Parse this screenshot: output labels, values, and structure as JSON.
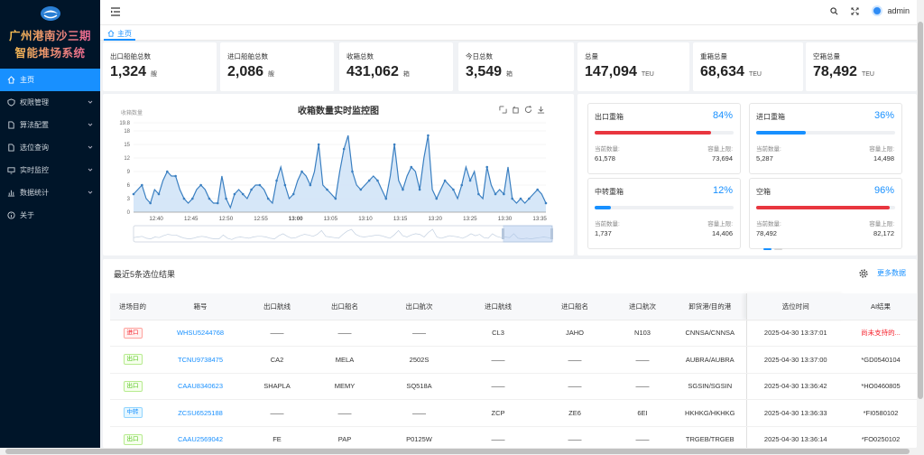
{
  "system_title_line1": "广州港南沙三期",
  "system_title_line2": "智能堆场系统",
  "menu": [
    {
      "label": "主页",
      "icon": "home-icon",
      "active": true
    },
    {
      "label": "权限管理",
      "icon": "shield-icon"
    },
    {
      "label": "算法配置",
      "icon": "doc-icon"
    },
    {
      "label": "选位查询",
      "icon": "doc-icon"
    },
    {
      "label": "实时监控",
      "icon": "monitor-icon"
    },
    {
      "label": "数据统计",
      "icon": "chart-icon"
    },
    {
      "label": "关于",
      "icon": "info-icon"
    }
  ],
  "header": {
    "user": "admin"
  },
  "tab": {
    "home": "主页"
  },
  "stats": [
    {
      "title": "出口船舶总数",
      "value": "1,324",
      "unit": "艘"
    },
    {
      "title": "进口船舶总数",
      "value": "2,086",
      "unit": "艘"
    },
    {
      "title": "收箱总数",
      "value": "431,062",
      "unit": "箱"
    },
    {
      "title": "今日总数",
      "value": "3,549",
      "unit": "箱"
    },
    {
      "title": "总量",
      "value": "147,094",
      "unit": "TEU"
    },
    {
      "title": "重箱总量",
      "value": "68,634",
      "unit": "TEU"
    },
    {
      "title": "空箱总量",
      "value": "78,492",
      "unit": "TEU"
    }
  ],
  "chart_data": {
    "type": "area",
    "title": "收箱数量实时监控图",
    "ylabel": "收箱数量",
    "ylim": [
      0,
      19.8
    ],
    "y_ticks": [
      "0",
      "3",
      "6",
      "9",
      "12",
      "15",
      "18",
      "19.8"
    ],
    "x_ticks": [
      "12:40",
      "12:45",
      "12:50",
      "12:55",
      "13:00",
      "13:05",
      "13:10",
      "13:15",
      "13:20",
      "13:25",
      "13:30",
      "13:35"
    ],
    "values": [
      4,
      5,
      6,
      3,
      2,
      5,
      4,
      7,
      9,
      8,
      8,
      5,
      3,
      2,
      3,
      5,
      6,
      5,
      3,
      2,
      2,
      8,
      3,
      1,
      4,
      5,
      4,
      3,
      5,
      6,
      6,
      5,
      3,
      2,
      7,
      10,
      6,
      3,
      4,
      7,
      9,
      8,
      6,
      9,
      15,
      6,
      5,
      4,
      3,
      9,
      14,
      17,
      9,
      6,
      5,
      6,
      7,
      8,
      7,
      5,
      3,
      8,
      15,
      7,
      5,
      8,
      10,
      9,
      5,
      12,
      17,
      5,
      3,
      5,
      7,
      6,
      5,
      3,
      6,
      10,
      7,
      9,
      4,
      3,
      10,
      6,
      4,
      5,
      4,
      10,
      3,
      2,
      3,
      2,
      3,
      4,
      5,
      4,
      2
    ]
  },
  "progress": [
    {
      "title": "出口重箱",
      "percent": 84,
      "pct_label": "84%",
      "color": "#e8363f",
      "cur_label": "当前数量:",
      "cur": "61,578",
      "cap_label": "容量上限:",
      "cap": "73,694"
    },
    {
      "title": "进口重箱",
      "percent": 36,
      "pct_label": "36%",
      "color": "#1890ff",
      "cur_label": "当前数量:",
      "cur": "5,287",
      "cap_label": "容量上限:",
      "cap": "14,498"
    },
    {
      "title": "中转重箱",
      "percent": 12,
      "pct_label": "12%",
      "color": "#1890ff",
      "cur_label": "当前数量:",
      "cur": "1,737",
      "cap_label": "容量上限:",
      "cap": "14,406"
    },
    {
      "title": "空箱",
      "percent": 96,
      "pct_label": "96%",
      "color": "#e8363f",
      "cur_label": "当前数量:",
      "cur": "78,492",
      "cap_label": "容量上限:",
      "cap": "82,172"
    }
  ],
  "table": {
    "title": "最近5条选位结果",
    "more": "更多数据",
    "columns": [
      "进场目的",
      "箱号",
      "出口航线",
      "出口船名",
      "出口航次",
      "进口航线",
      "进口船名",
      "进口航次",
      "卸货港/目的港",
      "选位时间",
      "AI结果"
    ],
    "rows": [
      {
        "purpose": "进口",
        "type": "in",
        "box": "WHSU5244768",
        "out_route": "——",
        "out_ship": "——",
        "out_voy": "——",
        "in_route": "CL3",
        "in_ship": "JAHO",
        "in_voy": "N103",
        "port": "CNNSA/CNNSA",
        "time": "2025-04-30 13:37:01",
        "ai": "尚未支持的...",
        "ai_err": true
      },
      {
        "purpose": "出口",
        "type": "out",
        "box": "TCNU9738475",
        "out_route": "CA2",
        "out_ship": "MELA",
        "out_voy": "2502S",
        "in_route": "——",
        "in_ship": "——",
        "in_voy": "——",
        "port": "AUBRA/AUBRA",
        "time": "2025-04-30 13:37:00",
        "ai": "*GD0540104"
      },
      {
        "purpose": "出口",
        "type": "out",
        "box": "CAAU8340623",
        "out_route": "SHAPLA",
        "out_ship": "MEMY",
        "out_voy": "SQ518A",
        "in_route": "——",
        "in_ship": "——",
        "in_voy": "——",
        "port": "SGSIN/SGSIN",
        "time": "2025-04-30 13:36:42",
        "ai": "*HO0460805"
      },
      {
        "purpose": "中转",
        "type": "mid",
        "box": "ZCSU6525188",
        "out_route": "——",
        "out_ship": "——",
        "out_voy": "——",
        "in_route": "ZCP",
        "in_ship": "ZE6",
        "in_voy": "6EI",
        "port": "HKHKG/HKHKG",
        "time": "2025-04-30 13:36:33",
        "ai": "*FI0580102"
      },
      {
        "purpose": "出口",
        "type": "out",
        "box": "CAAU2569042",
        "out_route": "FE",
        "out_ship": "PAP",
        "out_voy": "P0125W",
        "in_route": "——",
        "in_ship": "——",
        "in_voy": "——",
        "port": "TRGEB/TRGEB",
        "time": "2025-04-30 13:36:14",
        "ai": "*FO0250102"
      }
    ]
  }
}
